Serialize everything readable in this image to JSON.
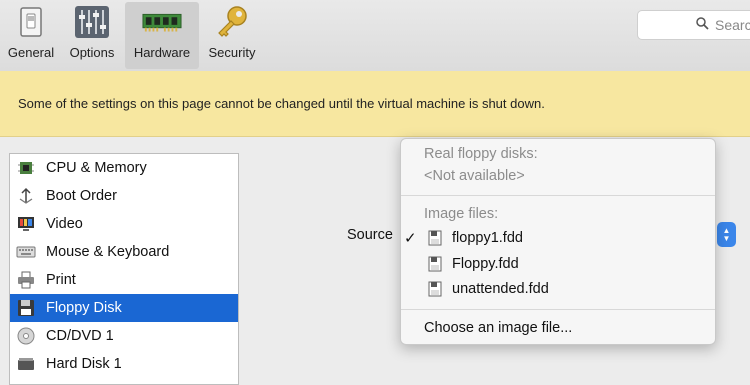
{
  "toolbar": {
    "tabs": [
      {
        "label": "General",
        "icon": "general-icon"
      },
      {
        "label": "Options",
        "icon": "options-sliders-icon"
      },
      {
        "label": "Hardware",
        "icon": "hardware-ram-icon"
      },
      {
        "label": "Security",
        "icon": "security-key-icon"
      }
    ],
    "selected_tab": "Hardware",
    "search": {
      "placeholder": "Search"
    }
  },
  "banner": {
    "message": "Some of the settings on this page cannot be changed until the virtual machine is shut down.",
    "color": "#f7e7a0"
  },
  "sidebar": {
    "items": [
      {
        "label": "CPU & Memory",
        "icon": "cpu-chip-icon"
      },
      {
        "label": "Boot Order",
        "icon": "boot-order-icon"
      },
      {
        "label": "Video",
        "icon": "video-monitor-icon"
      },
      {
        "label": "Mouse & Keyboard",
        "icon": "keyboard-icon"
      },
      {
        "label": "Print",
        "icon": "printer-icon"
      },
      {
        "label": "Floppy Disk",
        "icon": "floppy-disk-icon"
      },
      {
        "label": "CD/DVD 1",
        "icon": "cd-dvd-icon"
      },
      {
        "label": "Hard Disk 1",
        "icon": "hard-disk-icon"
      }
    ],
    "selected": "Floppy Disk",
    "selection_color": "#1a67d3"
  },
  "source": {
    "label": "Source",
    "menu": {
      "real_header": "Real floppy disks:",
      "real_none": "<Not available>",
      "image_header": "Image files:",
      "files": [
        "floppy1.fdd",
        "Floppy.fdd",
        "unattended.fdd"
      ],
      "checked_file": "floppy1.fdd",
      "check_mark": "✓",
      "choose_label": "Choose an image file..."
    },
    "accent": "#3b86ea"
  }
}
